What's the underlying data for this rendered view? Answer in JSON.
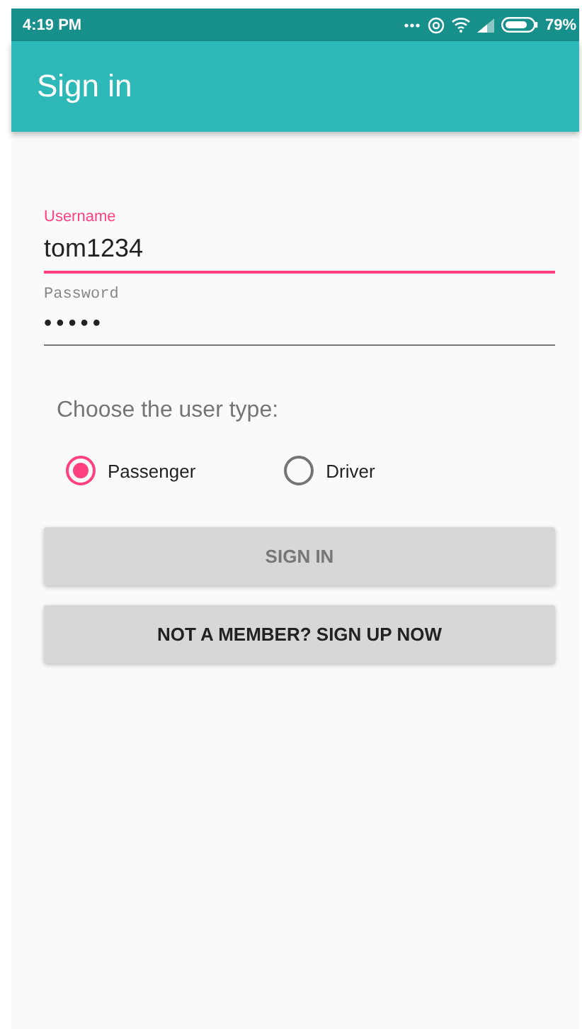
{
  "status_bar": {
    "time": "4:19 PM",
    "battery": "79%"
  },
  "app_bar": {
    "title": "Sign in"
  },
  "fields": [
    {
      "label": "Username",
      "value": "tom1234",
      "focused": true,
      "kind": "text"
    },
    {
      "label": "Password",
      "value": "•••••",
      "focused": false,
      "kind": "password"
    }
  ],
  "user_type": {
    "prompt": "Choose the user type:",
    "options": [
      {
        "label": "Passenger",
        "selected": true
      },
      {
        "label": "Driver",
        "selected": false
      }
    ]
  },
  "buttons": [
    {
      "label": "SIGN IN",
      "disabled": true
    },
    {
      "label": "NOT A MEMBER? SIGN UP NOW",
      "disabled": false
    }
  ]
}
